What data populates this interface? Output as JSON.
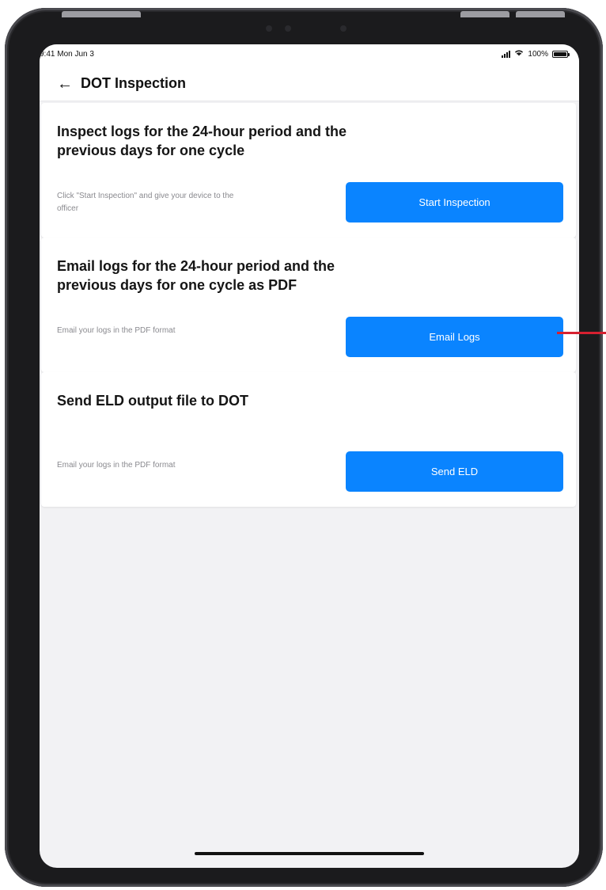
{
  "status_bar": {
    "time": "9:41 Mon Jun 3",
    "battery": "100%"
  },
  "header": {
    "back_icon": "arrow-left-icon",
    "title": "DOT Inspection"
  },
  "cards": [
    {
      "title": "Inspect logs for the 24-hour period and the previous days for one cycle",
      "description": "Click \"Start Inspection\" and give your device to the officer",
      "button": "Start Inspection"
    },
    {
      "title": "Email logs for the 24-hour period and the previous days for one cycle as PDF",
      "description": "Email your logs in the PDF format",
      "button": "Email Logs"
    },
    {
      "title": "Send ELD output file to DOT",
      "description": "Email your logs in the PDF format",
      "button": "Send ELD"
    }
  ],
  "colors": {
    "accent": "#0a84ff",
    "background": "#f2f2f4",
    "annotation": "#d62030"
  }
}
